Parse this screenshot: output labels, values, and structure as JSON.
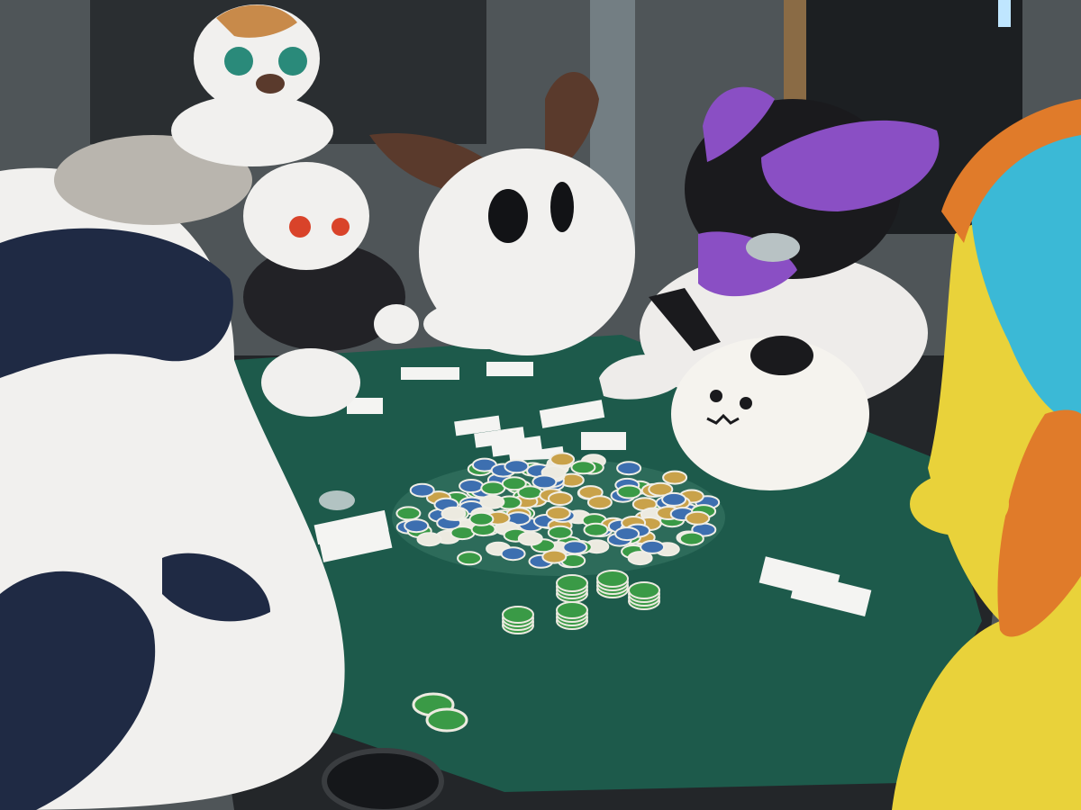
{
  "scene": {
    "description_free": true,
    "elements": {
      "community_cards": 5,
      "card_groups_on_table": 7,
      "costumed_players": 7
    },
    "colors": {
      "felt": "#1d5a4b",
      "felt_dark": "#0f3b31",
      "table_rail": "#2a2d30",
      "wall": "#5b6266",
      "chip_blue": "#3d6fb0",
      "chip_green": "#3a9a46",
      "chip_gold": "#c9a24a",
      "chip_white": "#eceae0",
      "fur_white": "#f1f0ee",
      "fur_navy": "#1f2a44",
      "fur_purple": "#8a4fc4",
      "fur_yellow": "#e9d23a",
      "fur_cyan": "#3bb9d6",
      "fur_orange": "#e07b2a",
      "ear_brown": "#5a3a2c"
    },
    "icons": [
      "card-icon",
      "chip-icon",
      "cup-holder-icon"
    ]
  }
}
